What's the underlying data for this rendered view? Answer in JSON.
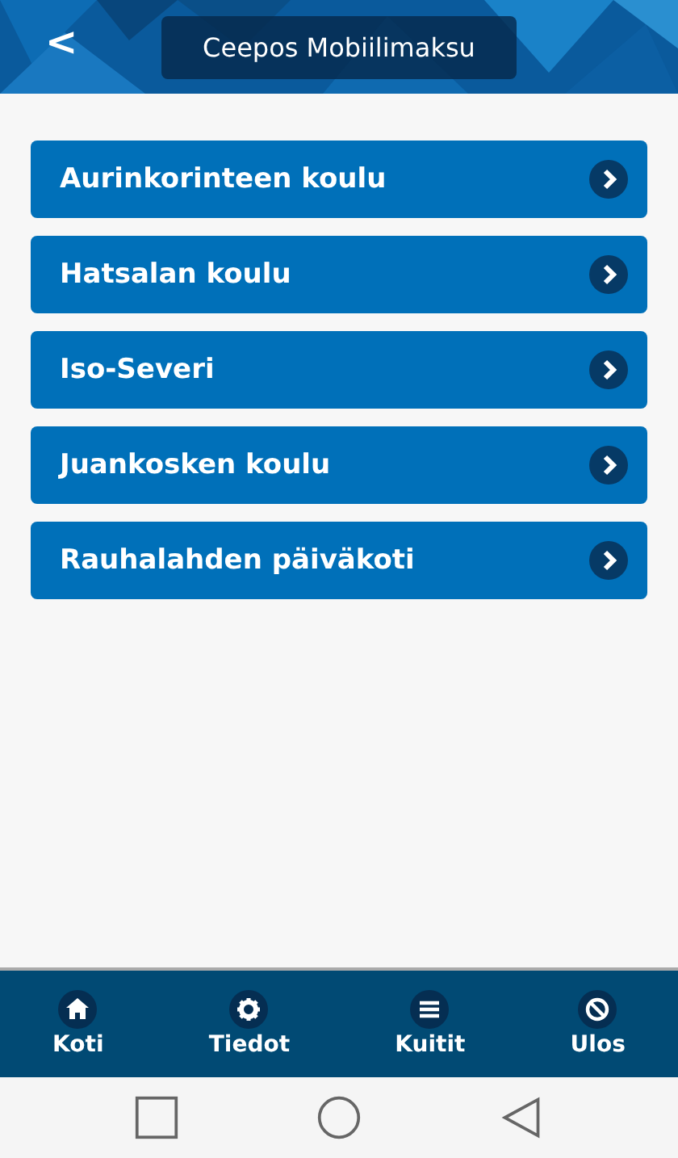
{
  "header": {
    "back": "<",
    "title": "Ceepos Mobiilimaksu"
  },
  "items": [
    {
      "label": "Aurinkorinteen koulu"
    },
    {
      "label": "Hatsalan koulu"
    },
    {
      "label": "Iso-Severi"
    },
    {
      "label": "Juankosken koulu"
    },
    {
      "label": "Rauhalahden päiväkoti"
    }
  ],
  "tabs": [
    {
      "label": "Koti"
    },
    {
      "label": "Tiedot"
    },
    {
      "label": "Kuitit"
    },
    {
      "label": "Ulos"
    }
  ]
}
